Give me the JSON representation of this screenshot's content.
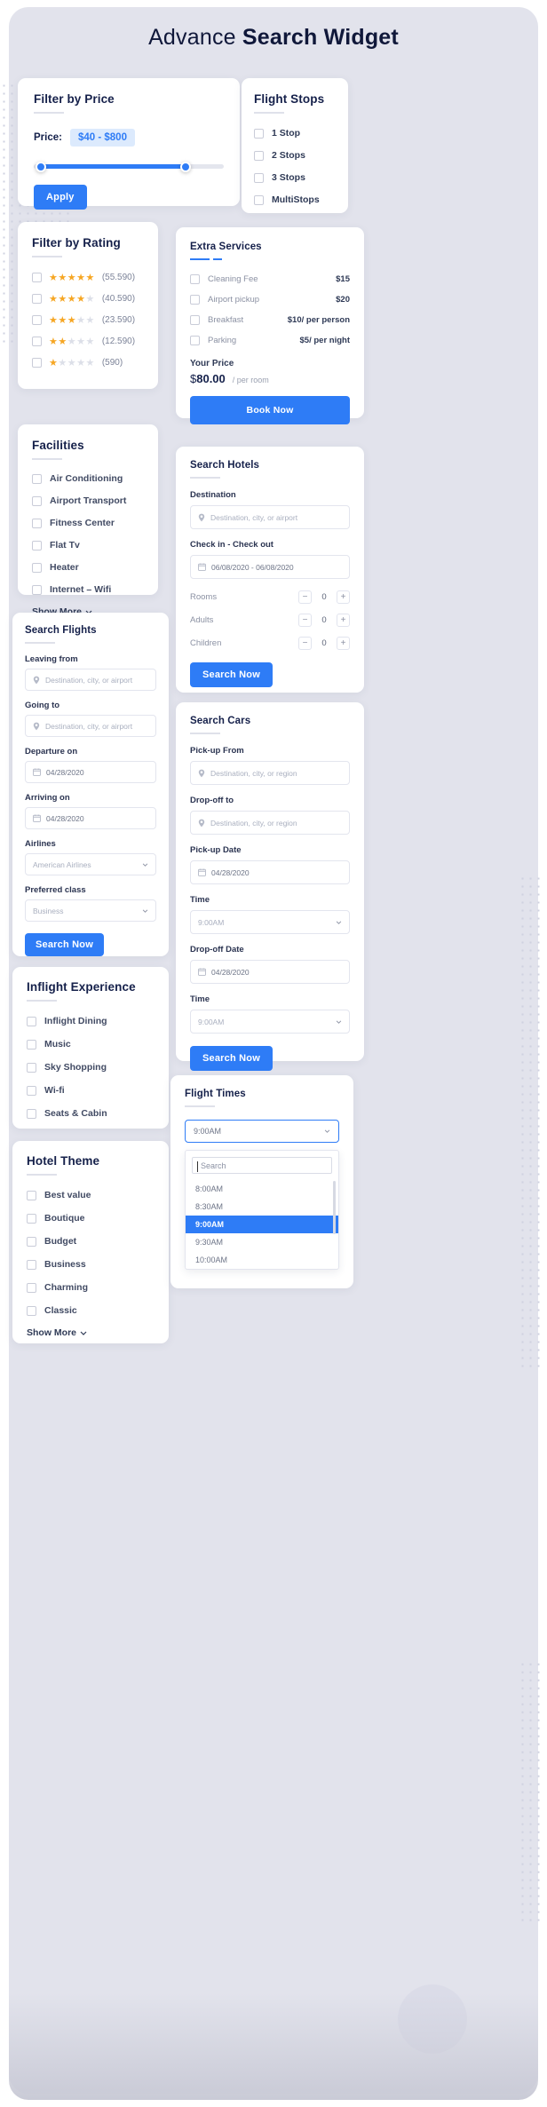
{
  "header": {
    "title_light": "Advance ",
    "title_bold": "Search Widget"
  },
  "colors": {
    "accent": "#2e7cf6",
    "bg": "#e2e3ec",
    "card": "#ffffff",
    "star": "#f6a623"
  },
  "filter_price": {
    "title": "Filter by Price",
    "price_label": "Price:",
    "price_value": "$40 - $800",
    "apply_label": "Apply"
  },
  "flight_stops": {
    "title": "Flight Stops",
    "options": [
      "1 Stop",
      "2 Stops",
      "3 Stops",
      "MultiStops"
    ]
  },
  "filter_rating": {
    "title": "Filter by Rating",
    "rows": [
      {
        "stars": 5,
        "count": "(55.590)"
      },
      {
        "stars": 4,
        "count": "(40.590)"
      },
      {
        "stars": 3,
        "count": "(23.590)"
      },
      {
        "stars": 2,
        "count": "(12.590)"
      },
      {
        "stars": 1,
        "count": "(590)"
      }
    ]
  },
  "extra_services": {
    "title": "Extra Services",
    "items": [
      {
        "name": "Cleaning Fee",
        "price": "$15"
      },
      {
        "name": "Airport pickup",
        "price": "$20"
      },
      {
        "name": "Breakfast",
        "price": "$10/ per person"
      },
      {
        "name": "Parking",
        "price": "$5/ per night"
      }
    ],
    "your_price_label": "Your Price",
    "currency": "$",
    "amount": "80.00",
    "per": "/ per room",
    "book_label": "Book Now"
  },
  "facilities": {
    "title": "Facilities",
    "options": [
      "Air Conditioning",
      "Airport Transport",
      "Fitness Center",
      "Flat Tv",
      "Heater",
      "Internet – Wifi"
    ],
    "show_more": "Show More"
  },
  "search_hotels": {
    "title": "Search Hotels",
    "destination_label": "Destination",
    "destination_placeholder": "Destination, city, or airport",
    "dates_label": "Check in - Check out",
    "dates_value": "06/08/2020 - 06/08/2020",
    "steppers": [
      {
        "name": "Rooms",
        "value": "0"
      },
      {
        "name": "Adults",
        "value": "0"
      },
      {
        "name": "Children",
        "value": "0"
      }
    ],
    "search_label": "Search Now"
  },
  "search_flights": {
    "title": "Search Flights",
    "leaving_label": "Leaving from",
    "leaving_placeholder": "Destination, city, or airport",
    "going_label": "Going to",
    "going_placeholder": "Destination, city, or airport",
    "departure_label": "Departure on",
    "departure_value": "04/28/2020",
    "arriving_label": "Arriving on",
    "arriving_value": "04/28/2020",
    "airlines_label": "Airlines",
    "airlines_value": "American Airlines",
    "class_label": "Preferred class",
    "class_value": "Business",
    "search_label": "Search Now"
  },
  "search_cars": {
    "title": "Search Cars",
    "pickup_from_label": "Pick-up From",
    "pickup_from_placeholder": "Destination, city, or region",
    "dropoff_to_label": "Drop-off to",
    "dropoff_to_placeholder": "Destination, city, or region",
    "pickup_date_label": "Pick-up Date",
    "pickup_date_value": "04/28/2020",
    "pickup_time_label": "Time",
    "pickup_time_value": "9:00AM",
    "dropoff_date_label": "Drop-off Date",
    "dropoff_date_value": "04/28/2020",
    "dropoff_time_label": "Time",
    "dropoff_time_value": "9:00AM",
    "search_label": "Search Now"
  },
  "inflight": {
    "title": "Inflight Experience",
    "options": [
      "Inflight Dining",
      "Music",
      "Sky Shopping",
      "Wi-fi",
      "Seats & Cabin"
    ]
  },
  "hotel_theme": {
    "title": "Hotel Theme",
    "options": [
      "Best value",
      "Boutique",
      "Budget",
      "Business",
      "Charming",
      "Classic"
    ],
    "show_more": "Show More"
  },
  "flight_times": {
    "title": "Flight Times",
    "selected": "9:00AM",
    "search_placeholder": "Search",
    "options": [
      "8:00AM",
      "8:30AM",
      "9:00AM",
      "9:30AM",
      "10:00AM"
    ],
    "selected_index": 2
  }
}
